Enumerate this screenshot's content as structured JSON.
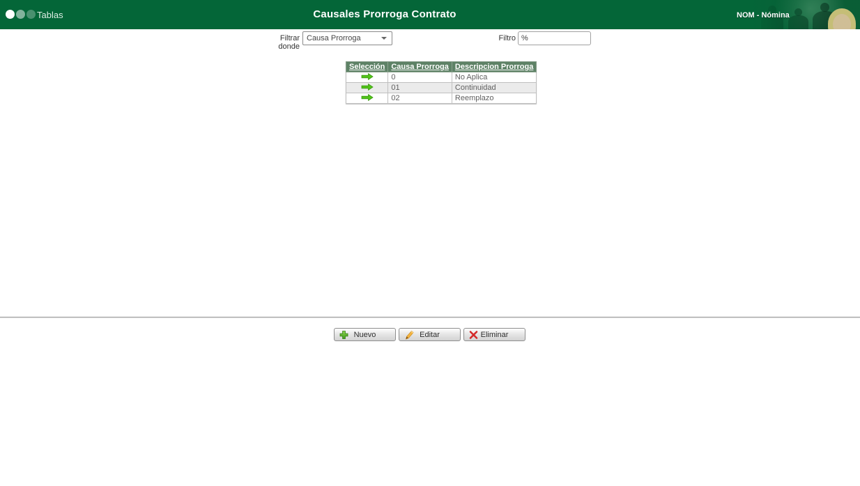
{
  "header": {
    "app_label": "Tablas",
    "title": "Causales Prorroga Contrato",
    "module_label": "NOM - Nómina"
  },
  "filter": {
    "where_label": "Filtrar donde",
    "where_value": "Causa Prorroga",
    "filter_label": "Filtro",
    "filter_value": "%"
  },
  "table": {
    "columns": [
      "Selección",
      "Causa Prorroga",
      "Descripcion Prorroga"
    ],
    "rows": [
      {
        "causa": "0",
        "descripcion": "No Aplica"
      },
      {
        "causa": "01",
        "descripcion": "Continuidad"
      },
      {
        "causa": "02",
        "descripcion": "Reemplazo"
      }
    ]
  },
  "actions": {
    "new_label": "Nuevo",
    "edit_label": "Editar",
    "delete_label": "Eliminar"
  },
  "colors": {
    "header_green": "#046638",
    "table_header_green": "#5e8266",
    "row_alt_gray": "#ebebeb",
    "arrow_green": "#52c41a",
    "plus_green": "#4ca81c",
    "pencil_orange": "#f5b43f",
    "delete_red": "#d42a2a"
  }
}
